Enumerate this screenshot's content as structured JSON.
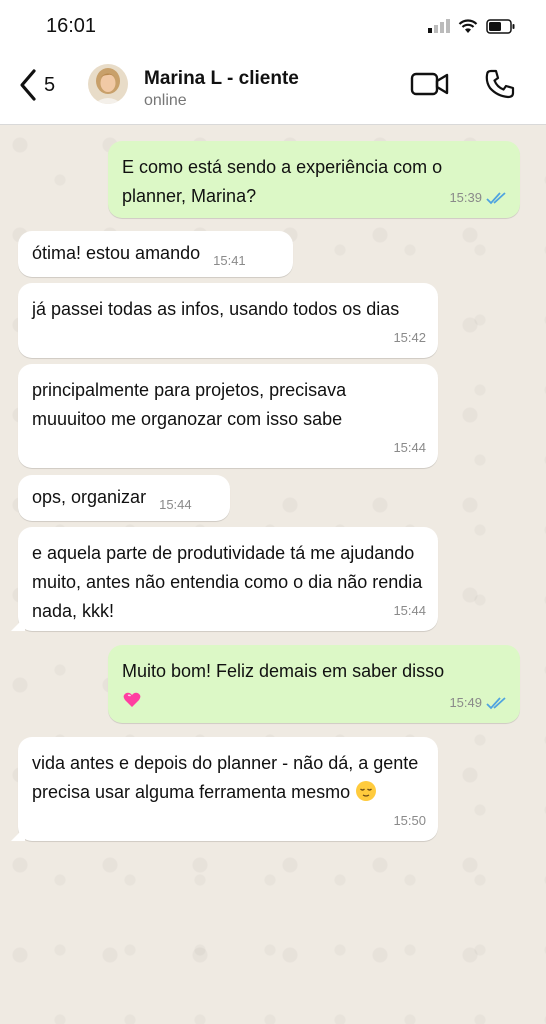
{
  "status_bar": {
    "time": "16:01"
  },
  "header": {
    "back_count": "5",
    "contact_name": "Marina L - cliente",
    "contact_status": "online"
  },
  "messages": [
    {
      "direction": "out",
      "text": "E como está sendo a experiência com o planner, Marina?",
      "time": "15:39",
      "read": true
    },
    {
      "direction": "in",
      "text": "ótima! estou amando",
      "time": "15:41"
    },
    {
      "direction": "in",
      "text": "já passei todas as infos, usando todos os dias",
      "time": "15:42"
    },
    {
      "direction": "in",
      "text": "principalmente para projetos, precisava muuuitoo me organozar com isso sabe",
      "time": "15:44"
    },
    {
      "direction": "in",
      "text": "ops, organizar",
      "time": "15:44"
    },
    {
      "direction": "in",
      "text": "e aquela parte de produtividade tá me ajudando muito, antes não entendia como o dia não rendia nada, kkk!",
      "time": "15:44"
    },
    {
      "direction": "out",
      "text": "Muito bom! Feliz demais em saber disso",
      "emoji": "sparkling-heart",
      "time": "15:49",
      "read": true
    },
    {
      "direction": "in",
      "text": "vida antes e depois do planner - não dá, a gente precisa usar alguma ferramenta mesmo",
      "emoji": "relieved-face",
      "time": "15:50"
    }
  ],
  "colors": {
    "outgoing_bubble": "#dcf8c6",
    "incoming_bubble": "#ffffff",
    "chat_background": "#efeae2",
    "read_ticks": "#4fa3e0"
  }
}
